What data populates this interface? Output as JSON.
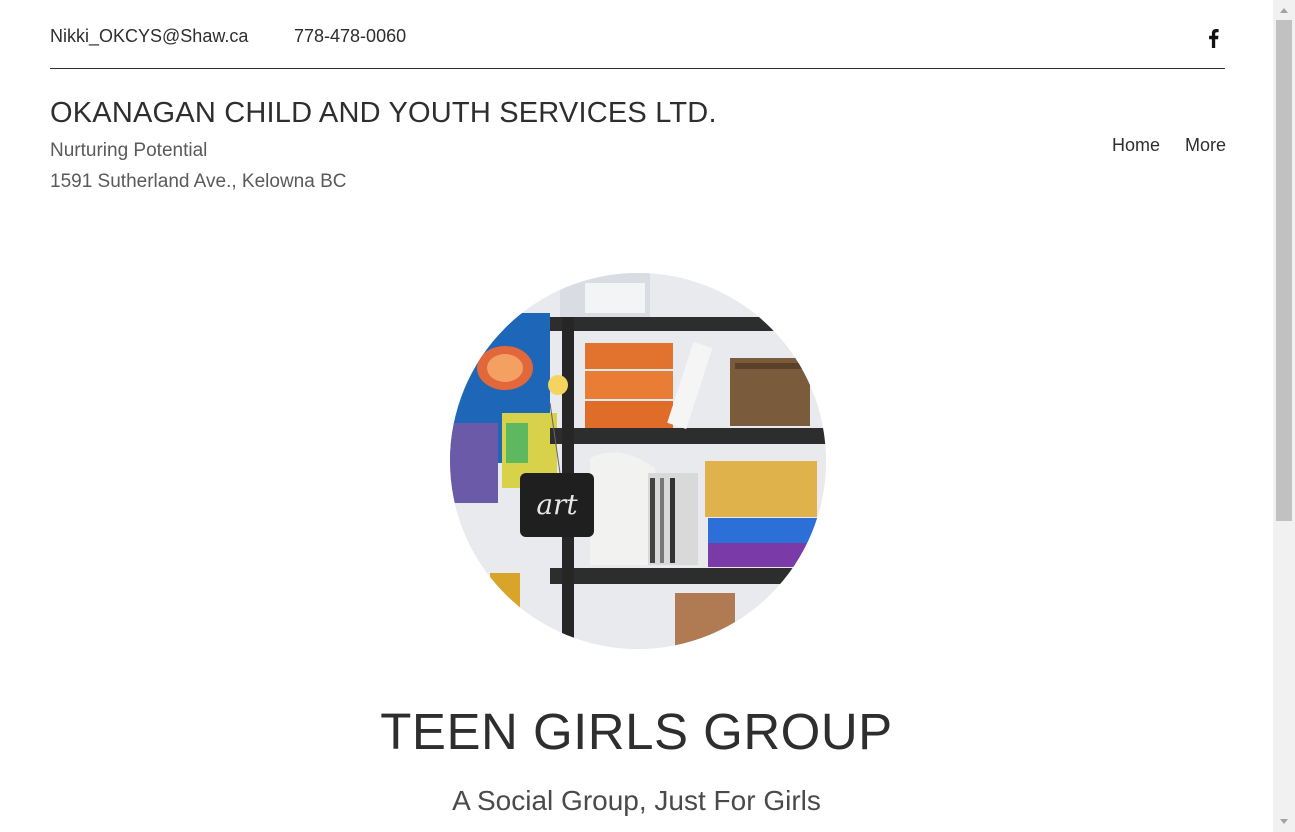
{
  "header": {
    "email": "Nikki_OKCYS@Shaw.ca",
    "phone": "778-478-0060",
    "social_icon": "facebook-icon"
  },
  "site": {
    "title": "OKANAGAN CHILD AND YOUTH SERVICES LTD.",
    "tagline": "Nurturing Potential",
    "address": "1591 Sutherland Ave., Kelowna BC"
  },
  "nav": {
    "items": [
      {
        "label": "Home"
      },
      {
        "label": "More"
      }
    ]
  },
  "hero": {
    "sign_text": "art",
    "headline": "TEEN GIRLS GROUP",
    "subheadline": "A Social Group, Just For Girls"
  },
  "colors": {
    "text": "#2f2e2e",
    "background": "#ffffff",
    "scrollbar_track": "#f1f1f1",
    "scrollbar_thumb": "#c1c1c1"
  }
}
